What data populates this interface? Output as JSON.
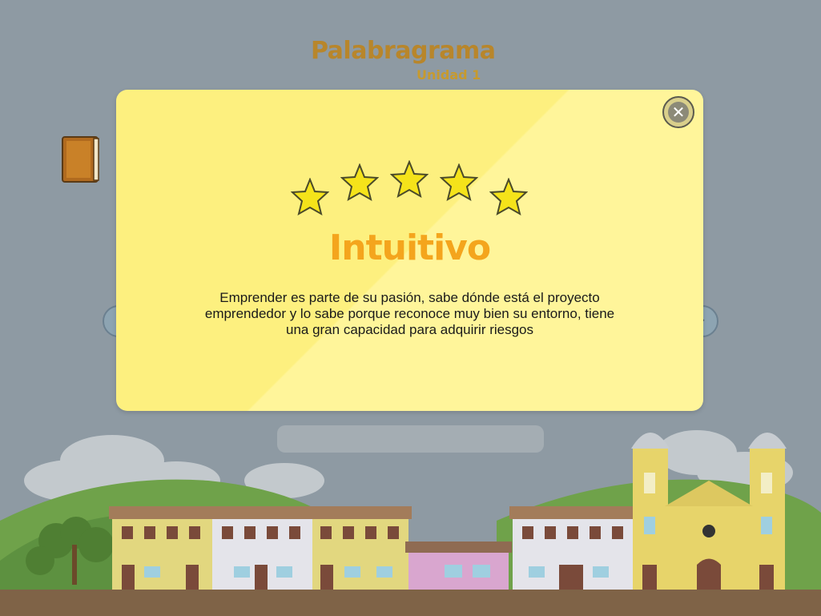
{
  "header": {
    "title": "Palabragrama",
    "subtitle": "Unidad 1"
  },
  "modal": {
    "rating": {
      "value": 5,
      "max": 5
    },
    "result_title": "Intuitivo",
    "result_text": "Emprender es parte de su pasión, sabe dónde está el proyecto emprendedor y lo sabe porque reconoce muy bien su entorno, tiene una gran capacidad para adquirir riesgos",
    "close_icon": "close-icon"
  },
  "icons": {
    "star": "star-icon",
    "book": "book-icon",
    "prev": "chevron-left-icon",
    "next": "chevron-right-icon"
  },
  "colors": {
    "sky": "#8e9aa3",
    "modal_bg": "#fdf07f",
    "title_orange": "#f4a51d",
    "header_gold": "#b8862b",
    "star_yellow": "#f5e31a"
  }
}
